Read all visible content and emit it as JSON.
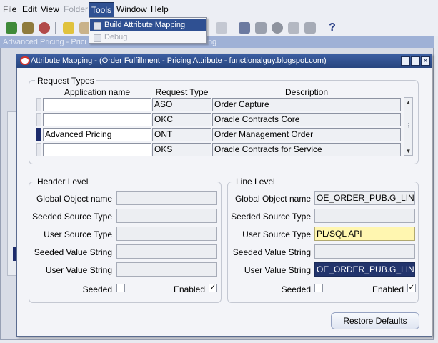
{
  "menu": {
    "file": "File",
    "edit": "Edit",
    "view": "View",
    "folder": "Folder",
    "tools": "Tools",
    "window": "Window",
    "help": "Help"
  },
  "tools_menu": {
    "items": [
      {
        "label": "Build Attribute Mapping Rules",
        "highlighted": true
      },
      {
        "label": "Debug",
        "disabled": true
      }
    ]
  },
  "background_window": {
    "title_left": "Advanced Pricing - Prici",
    "title_right": "king"
  },
  "dialog": {
    "title": "Attribute Mapping - (Order Fulfillment - Pricing Attribute - functionalguy.blogspot.com)",
    "request_types": {
      "group_label": "Request Types",
      "headers": [
        "Application name",
        "Request Type",
        "Description"
      ],
      "rows": [
        {
          "app": "",
          "type": "ASO",
          "desc": "Order Capture"
        },
        {
          "app": "",
          "type": "OKC",
          "desc": "Oracle Contracts Core"
        },
        {
          "app": "Advanced Pricing",
          "type": "ONT",
          "desc": "Order Management Order"
        },
        {
          "app": "",
          "type": "OKS",
          "desc": "Oracle Contracts for Service"
        }
      ]
    },
    "header_level": {
      "group_label": "Header Level",
      "labels": [
        "Global Object name",
        "Seeded Source Type",
        "User Source Type",
        "Seeded Value String",
        "User Value String"
      ],
      "values": [
        "",
        "",
        "",
        "",
        ""
      ],
      "seeded_label": "Seeded",
      "enabled_label": "Enabled",
      "seeded_checked": false,
      "enabled_checked": true
    },
    "line_level": {
      "group_label": "Line Level",
      "labels": [
        "Global Object name",
        "Seeded Source Type",
        "User Source Type",
        "Seeded Value String",
        "User Value String"
      ],
      "values": [
        "OE_ORDER_PUB.G_LINE",
        "",
        "PL/SQL API",
        "",
        "OE_ORDER_PUB.G_LINE"
      ],
      "seeded_label": "Seeded",
      "enabled_label": "Enabled",
      "seeded_checked": false,
      "enabled_checked": true
    },
    "restore_label": "Restore Defaults"
  },
  "colors": {
    "title_bar": "#2f4f8f",
    "selection": "#22346c",
    "required_field": "#fff6b0",
    "oracle_red": "#d4332c"
  }
}
